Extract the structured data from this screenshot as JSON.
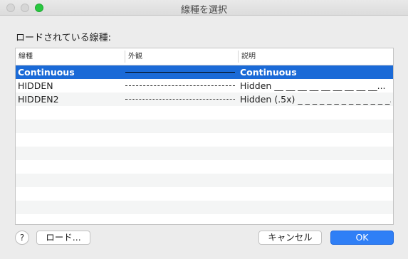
{
  "window": {
    "title": "線種を選択"
  },
  "section_label": "ロードされている線種:",
  "table": {
    "headers": {
      "name": "線種",
      "appearance": "外観",
      "description": "説明"
    },
    "rows": [
      {
        "name": "Continuous",
        "linestyle": "solid",
        "description": "Continuous",
        "selected": true
      },
      {
        "name": "HIDDEN",
        "linestyle": "dashed",
        "description": "Hidden __ __ __ __ __ __ __ __ __...",
        "selected": false
      },
      {
        "name": "HIDDEN2",
        "linestyle": "dotted",
        "description": "Hidden (.5x) _ _ _ _ _ _ _ _ _ _ _ _ _...",
        "selected": false
      }
    ]
  },
  "buttons": {
    "help": "?",
    "load": "ロード...",
    "cancel": "キャンセル",
    "ok": "OK"
  },
  "colors": {
    "selection": "#1a6ad7",
    "primary_button": "#2f7ff6",
    "maximize": "#28c840"
  }
}
